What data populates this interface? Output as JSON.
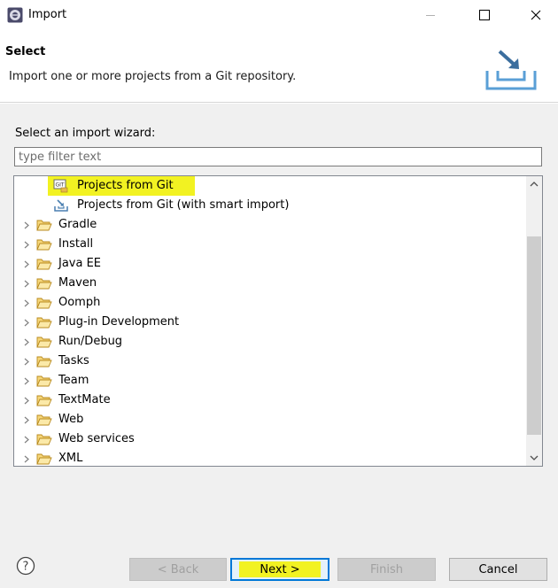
{
  "window": {
    "title": "Import",
    "icon": "eclipse-icon",
    "controls": [
      "minimize-icon",
      "maximize-icon",
      "close-icon"
    ]
  },
  "header": {
    "title": "Select",
    "description": "Import one or more projects from a Git repository.",
    "graphic": "import-banner-icon"
  },
  "wizard": {
    "label": "Select an import wizard:",
    "filter_placeholder": "type filter text",
    "filter_value": ""
  },
  "tree": {
    "items": [
      {
        "label": "Projects from Git",
        "icon": "git-icon",
        "expandable": false,
        "highlighted": true
      },
      {
        "label": "Projects from Git (with smart import)",
        "icon": "smart-import-icon",
        "expandable": false,
        "highlighted": false
      },
      {
        "label": "Gradle",
        "icon": "folder-icon",
        "expandable": true
      },
      {
        "label": "Install",
        "icon": "folder-icon",
        "expandable": true
      },
      {
        "label": "Java EE",
        "icon": "folder-icon",
        "expandable": true
      },
      {
        "label": "Maven",
        "icon": "folder-icon",
        "expandable": true
      },
      {
        "label": "Oomph",
        "icon": "folder-icon",
        "expandable": true
      },
      {
        "label": "Plug-in Development",
        "icon": "folder-icon",
        "expandable": true
      },
      {
        "label": "Run/Debug",
        "icon": "folder-icon",
        "expandable": true
      },
      {
        "label": "Tasks",
        "icon": "folder-icon",
        "expandable": true
      },
      {
        "label": "Team",
        "icon": "folder-icon",
        "expandable": true
      },
      {
        "label": "TextMate",
        "icon": "folder-icon",
        "expandable": true
      },
      {
        "label": "Web",
        "icon": "folder-icon",
        "expandable": true
      },
      {
        "label": "Web services",
        "icon": "folder-icon",
        "expandable": true
      },
      {
        "label": "XML",
        "icon": "folder-icon",
        "expandable": true
      }
    ]
  },
  "footer": {
    "help_icon": "help-icon",
    "back_label": "< Back",
    "next_label": "Next >",
    "finish_label": "Finish",
    "cancel_label": "Cancel"
  },
  "colors": {
    "highlight": "#f2f222",
    "default_button_border": "#0078d7",
    "folder": "#e8b84a"
  }
}
